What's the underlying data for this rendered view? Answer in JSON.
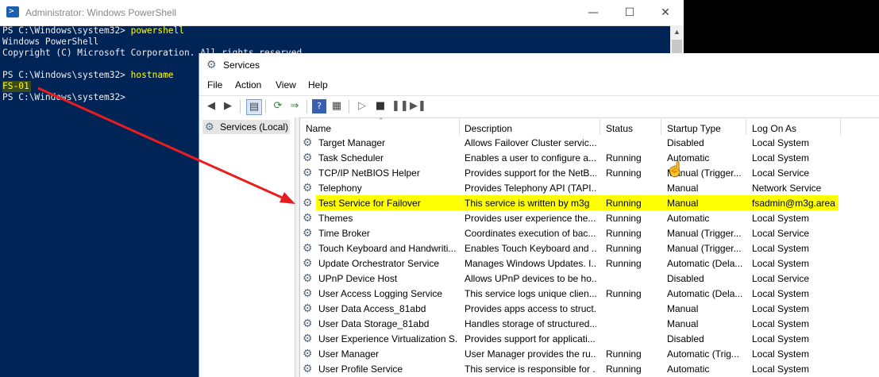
{
  "powershell": {
    "title": "Administrator: Windows PowerShell",
    "lines": [
      {
        "prompt": "PS C:\\Windows\\system32> ",
        "cmd": "powershell"
      },
      {
        "text": "Windows PowerShell"
      },
      {
        "text": "Copyright (C) Microsoft Corporation. All rights reserved."
      },
      {
        "prompt": "PS C:\\Windows\\system32> ",
        "cmd": "hostname"
      },
      {
        "text": "FS-01"
      },
      {
        "prompt": "PS C:\\Windows\\system32>"
      }
    ]
  },
  "services": {
    "title": "Services",
    "menu": [
      "File",
      "Action",
      "View",
      "Help"
    ],
    "tree_item": "Services (Local)",
    "columns": [
      "Name",
      "Description",
      "Status",
      "Startup Type",
      "Log On As"
    ],
    "rows": [
      {
        "name": "Target Manager",
        "desc": "Allows Failover Cluster servic...",
        "status": "",
        "startup": "Disabled",
        "logon": "Local System"
      },
      {
        "name": "Task Scheduler",
        "desc": "Enables a user to configure a...",
        "status": "Running",
        "startup": "Automatic",
        "logon": "Local System"
      },
      {
        "name": "TCP/IP NetBIOS Helper",
        "desc": "Provides support for the NetB...",
        "status": "Running",
        "startup": "Manual (Trigger...",
        "logon": "Local Service"
      },
      {
        "name": "Telephony",
        "desc": "Provides Telephony API (TAPI...",
        "status": "",
        "startup": "Manual",
        "logon": "Network Service"
      },
      {
        "name": "Test Service for Failover",
        "desc": "This service is written by m3g",
        "status": "Running",
        "startup": "Manual",
        "logon": "fsadmin@m3g.area",
        "highlight": true
      },
      {
        "name": "Themes",
        "desc": "Provides user experience the...",
        "status": "Running",
        "startup": "Automatic",
        "logon": "Local System"
      },
      {
        "name": "Time Broker",
        "desc": "Coordinates execution of bac...",
        "status": "Running",
        "startup": "Manual (Trigger...",
        "logon": "Local Service"
      },
      {
        "name": "Touch Keyboard and Handwriti...",
        "desc": "Enables Touch Keyboard and ...",
        "status": "Running",
        "startup": "Manual (Trigger...",
        "logon": "Local System"
      },
      {
        "name": "Update Orchestrator Service",
        "desc": "Manages Windows Updates. I...",
        "status": "Running",
        "startup": "Automatic (Dela...",
        "logon": "Local System"
      },
      {
        "name": "UPnP Device Host",
        "desc": "Allows UPnP devices to be ho...",
        "status": "",
        "startup": "Disabled",
        "logon": "Local Service"
      },
      {
        "name": "User Access Logging Service",
        "desc": "This service logs unique clien...",
        "status": "Running",
        "startup": "Automatic (Dela...",
        "logon": "Local System"
      },
      {
        "name": "User Data Access_81abd",
        "desc": "Provides apps access to struct...",
        "status": "",
        "startup": "Manual",
        "logon": "Local System"
      },
      {
        "name": "User Data Storage_81abd",
        "desc": "Handles storage of structured...",
        "status": "",
        "startup": "Manual",
        "logon": "Local System"
      },
      {
        "name": "User Experience Virtualization S...",
        "desc": "Provides support for applicati...",
        "status": "",
        "startup": "Disabled",
        "logon": "Local System"
      },
      {
        "name": "User Manager",
        "desc": "User Manager provides the ru...",
        "status": "Running",
        "startup": "Automatic (Trig...",
        "logon": "Local System"
      },
      {
        "name": "User Profile Service",
        "desc": "This service is responsible for ...",
        "status": "Running",
        "startup": "Automatic",
        "logon": "Local System"
      }
    ]
  },
  "annotation_color": "#e81e1e",
  "highlight_color": "#ffff00"
}
